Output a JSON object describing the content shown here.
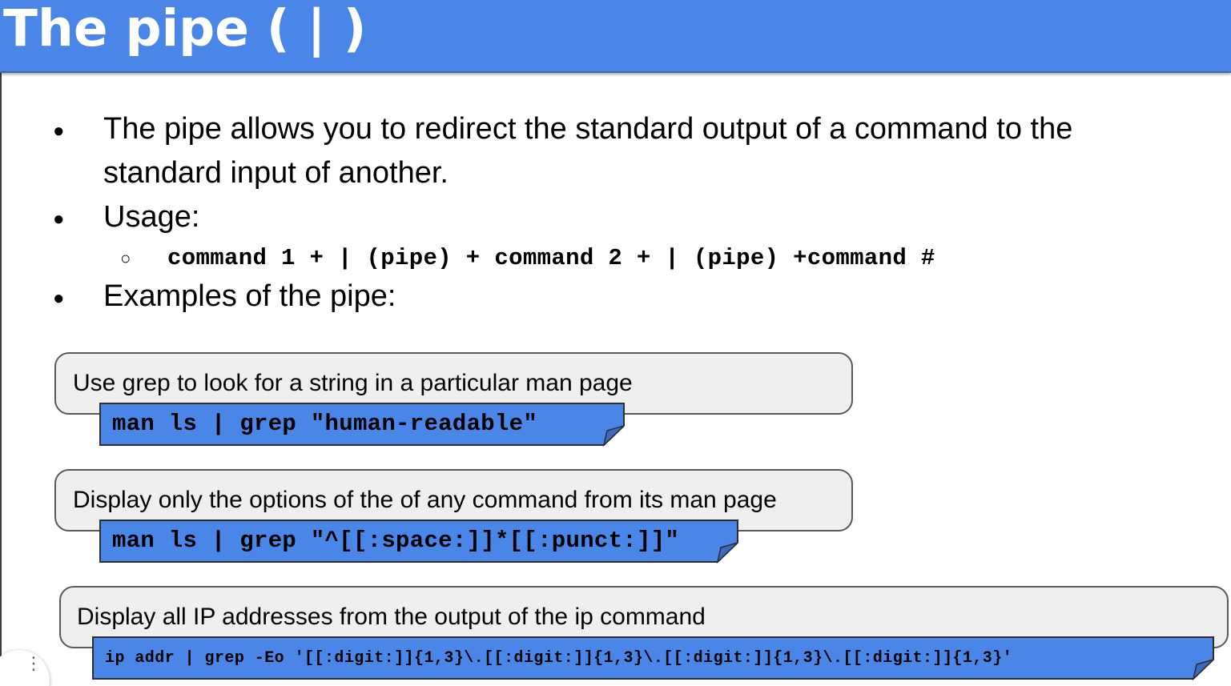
{
  "colors": {
    "header_bg": "#4a86e8",
    "code_bg": "#4a86e8",
    "code_border": "#2d2d2d",
    "box_bg": "#efefef",
    "box_border": "#595959"
  },
  "slide": {
    "title": "The pipe ( | )",
    "bullets": [
      {
        "marker": "●",
        "line1": "The pipe allows you to redirect the standard output of a command to the",
        "line2": "standard input of another."
      },
      {
        "marker": "●",
        "text": "Usage:"
      },
      {
        "marker": "●",
        "text": "Examples of the pipe:"
      }
    ],
    "usage": {
      "marker": "○",
      "code": "command 1 + | (pipe) + command 2 + | (pipe) +command #"
    },
    "examples": [
      {
        "description": "Use grep to look for a string in a particular man page",
        "code": "man ls | grep \"human-readable\""
      },
      {
        "description": "Display only the options of the of any command from its man page",
        "code": "man ls | grep \"^[[:space:]]*[[:punct:]]\""
      },
      {
        "description": "Display all IP addresses from the output of the ip command",
        "code": "ip addr | grep -Eo '[[:digit:]]{1,3}\\.[[:digit:]]{1,3}\\.[[:digit:]]{1,3}\\.[[:digit:]]{1,3}'"
      }
    ]
  },
  "toolbar": {
    "menu_icon": "vertical-dots-icon",
    "menu_glyph": "⋮"
  }
}
